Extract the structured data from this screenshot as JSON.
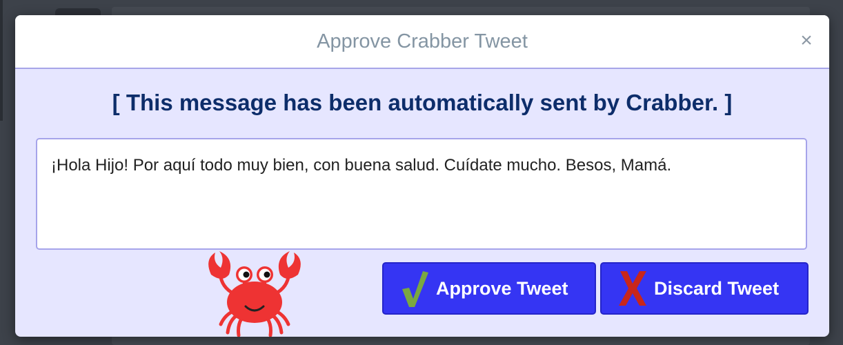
{
  "modal": {
    "title": "Approve Crabber Tweet",
    "close_symbol": "×",
    "notice": "[ This message has been automatically sent by Crabber. ]",
    "tweet_text": "¡Hola Hijo! Por aquí todo muy bien, con buena salud. Cuídate mucho. Besos, Mamá.",
    "buttons": {
      "approve_label": "Approve Tweet",
      "approve_icon": "check-icon",
      "discard_label": "Discard Tweet",
      "discard_icon": "x-icon"
    },
    "mascot": "crab-illustration"
  },
  "colors": {
    "modal_bg": "#e6e6ff",
    "notice_text": "#0d2d6a",
    "button_bg": "#3535f3",
    "check_green": "#7aa841",
    "x_red": "#c8261b",
    "crab_red": "#ee3333"
  }
}
